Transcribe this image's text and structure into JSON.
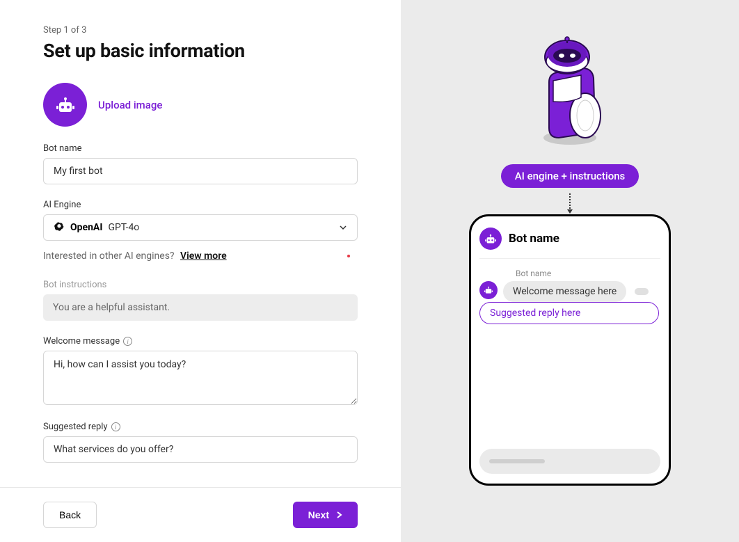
{
  "step_indicator": "Step 1 of 3",
  "title": "Set up basic information",
  "upload_link": "Upload image",
  "labels": {
    "bot_name": "Bot name",
    "ai_engine": "AI Engine",
    "bot_instructions": "Bot instructions",
    "welcome_message": "Welcome message",
    "suggested_reply": "Suggested reply"
  },
  "values": {
    "bot_name": "My first bot",
    "bot_instructions": "You are a helpful assistant.",
    "welcome_message": "Hi, how can I assist you today?",
    "suggested_reply": "What services do you offer?"
  },
  "engine": {
    "brand": "OpenAI",
    "model": "GPT-4o"
  },
  "engine_hint": "Interested in other AI engines?",
  "view_more": "View more",
  "buttons": {
    "back": "Back",
    "next": "Next"
  },
  "preview": {
    "pill": "AI engine + instructions",
    "header": "Bot name",
    "sender": "Bot name",
    "welcome": "Welcome message here",
    "suggested": "Suggested reply here"
  },
  "colors": {
    "accent": "#7b20d6"
  }
}
